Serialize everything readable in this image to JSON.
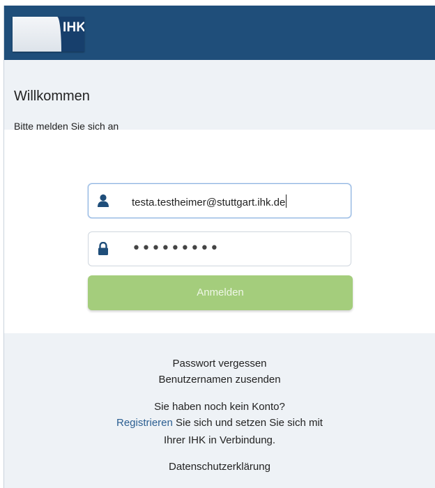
{
  "header": {
    "logo_text": "IHK",
    "brand_color": "#1f4e7a"
  },
  "welcome": {
    "title": "Willkommen",
    "subtitle": "Bitte melden Sie sich an"
  },
  "form": {
    "username": {
      "value": "testa.testheimer@stuttgart.ihk.de",
      "icon": "user-icon"
    },
    "password": {
      "masked_value": "•••••••••",
      "icon": "lock-icon"
    },
    "submit_label": "Anmelden",
    "submit_color": "#a4cd7c"
  },
  "footer": {
    "forgot_password": "Passwort vergessen",
    "send_username": "Benutzernamen zusenden",
    "no_account": "Sie haben noch kein Konto?",
    "register_link": "Registrieren",
    "register_text_1": " Sie sich und setzen Sie sich mit",
    "register_text_2": "Ihrer IHK in Verbindung.",
    "privacy": "Datenschutzerklärung",
    "link_color": "#2b5e91"
  }
}
